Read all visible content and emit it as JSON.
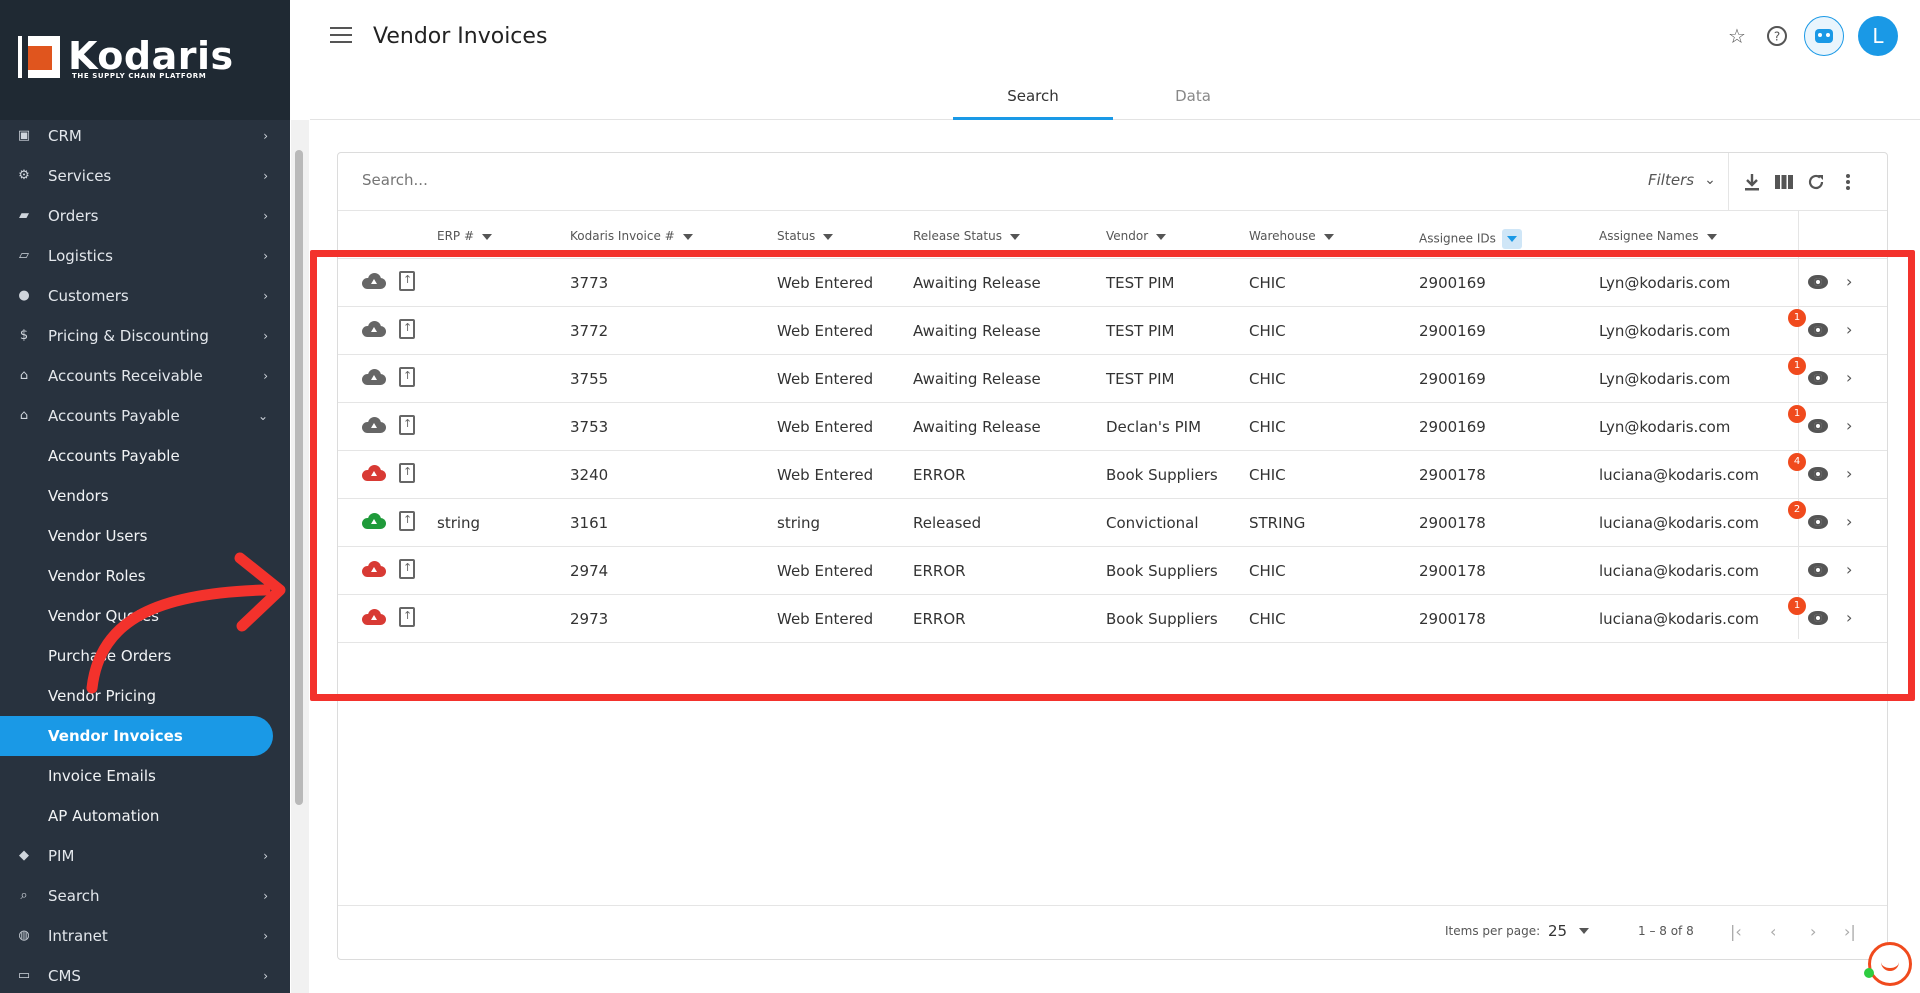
{
  "brand": {
    "name": "Kodaris",
    "tagline": "THE SUPPLY CHAIN PLATFORM"
  },
  "sidebar": {
    "items": [
      {
        "label": "CRM",
        "icon": "contact-card-icon"
      },
      {
        "label": "Services",
        "icon": "gears-icon"
      },
      {
        "label": "Orders",
        "icon": "truck-icon"
      },
      {
        "label": "Logistics",
        "icon": "delivery-truck-icon"
      },
      {
        "label": "Customers",
        "icon": "people-icon"
      },
      {
        "label": "Pricing & Discounting",
        "icon": "dollar-icon"
      },
      {
        "label": "Accounts Receivable",
        "icon": "bank-icon"
      },
      {
        "label": "Accounts Payable",
        "icon": "bank-icon"
      }
    ],
    "sub_items": [
      "Accounts Payable",
      "Vendors",
      "Vendor Users",
      "Vendor Roles",
      "Vendor Quotes",
      "Purchase Orders",
      "Vendor Pricing",
      "Vendor Invoices",
      "Invoice Emails",
      "AP Automation"
    ],
    "bottom_items": [
      {
        "label": "PIM",
        "icon": "tag-icon"
      },
      {
        "label": "Search",
        "icon": "search-icon"
      },
      {
        "label": "Intranet",
        "icon": "globe-icon"
      },
      {
        "label": "CMS",
        "icon": "browser-icon"
      }
    ],
    "active": "Vendor Invoices"
  },
  "header": {
    "title": "Vendor Invoices",
    "avatar_letter": "L",
    "tabs": [
      "Search",
      "Data"
    ],
    "active_tab": "Search"
  },
  "table": {
    "search_placeholder": "Search...",
    "filters_label": "Filters",
    "columns": [
      "ERP #",
      "Kodaris Invoice #",
      "Status",
      "Release Status",
      "Vendor",
      "Warehouse",
      "Assignee IDs",
      "Assignee Names"
    ],
    "sorted_column": "Assignee IDs",
    "rows": [
      {
        "sync": "gray",
        "erp": "",
        "invoice": "3773",
        "status": "Web Entered",
        "release": "Awaiting Release",
        "vendor": "TEST PIM",
        "warehouse": "CHIC",
        "assignee_id": "2900169",
        "assignee_name": "Lyn@kodaris.com",
        "badge": ""
      },
      {
        "sync": "gray",
        "erp": "",
        "invoice": "3772",
        "status": "Web Entered",
        "release": "Awaiting Release",
        "vendor": "TEST PIM",
        "warehouse": "CHIC",
        "assignee_id": "2900169",
        "assignee_name": "Lyn@kodaris.com",
        "badge": "1"
      },
      {
        "sync": "gray",
        "erp": "",
        "invoice": "3755",
        "status": "Web Entered",
        "release": "Awaiting Release",
        "vendor": "TEST PIM",
        "warehouse": "CHIC",
        "assignee_id": "2900169",
        "assignee_name": "Lyn@kodaris.com",
        "badge": "1"
      },
      {
        "sync": "gray",
        "erp": "",
        "invoice": "3753",
        "status": "Web Entered",
        "release": "Awaiting Release",
        "vendor": "Declan's PIM",
        "warehouse": "CHIC",
        "assignee_id": "2900169",
        "assignee_name": "Lyn@kodaris.com",
        "badge": "1"
      },
      {
        "sync": "red",
        "erp": "",
        "invoice": "3240",
        "status": "Web Entered",
        "release": "ERROR",
        "vendor": "Book Suppliers",
        "warehouse": "CHIC",
        "assignee_id": "2900178",
        "assignee_name": "luciana@kodaris.com",
        "badge": "4"
      },
      {
        "sync": "green",
        "erp": "string",
        "invoice": "3161",
        "status": "string",
        "release": "Released",
        "vendor": "Convictional",
        "warehouse": "STRING",
        "assignee_id": "2900178",
        "assignee_name": "luciana@kodaris.com",
        "badge": "2"
      },
      {
        "sync": "red",
        "erp": "",
        "invoice": "2974",
        "status": "Web Entered",
        "release": "ERROR",
        "vendor": "Book Suppliers",
        "warehouse": "CHIC",
        "assignee_id": "2900178",
        "assignee_name": "luciana@kodaris.com",
        "badge": ""
      },
      {
        "sync": "red",
        "erp": "",
        "invoice": "2973",
        "status": "Web Entered",
        "release": "ERROR",
        "vendor": "Book Suppliers",
        "warehouse": "CHIC",
        "assignee_id": "2900178",
        "assignee_name": "luciana@kodaris.com",
        "badge": "1"
      }
    ]
  },
  "pagination": {
    "items_per_page_label": "Items per page:",
    "items_per_page": "25",
    "range": "1 – 8 of 8"
  },
  "colors": {
    "accent": "#1a99e6",
    "sidebar_bg": "#28323e",
    "sync_gray": "#666666",
    "sync_red": "#d83a34",
    "sync_green": "#1f9a3a",
    "badge": "#f04a1d",
    "annotation": "#f3322c"
  }
}
